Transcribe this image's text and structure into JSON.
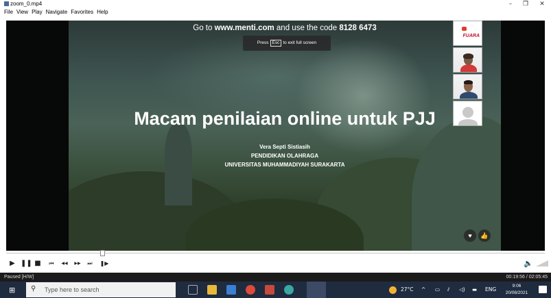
{
  "window": {
    "title": "zoom_0.mp4",
    "controls": [
      "–",
      "❐",
      "✕"
    ]
  },
  "menu": [
    "File",
    "View",
    "Play",
    "Navigate",
    "Favorites",
    "Help"
  ],
  "slide": {
    "top_banner_prefix": "Go to ",
    "top_banner_site": "www.menti.com",
    "top_banner_middle": " and use the code ",
    "top_banner_code": "8128 6473",
    "esc_prefix": "Press",
    "esc_key": "Esc",
    "esc_suffix": "to exit full screen",
    "title": "Macam penilaian online untuk PJJ",
    "author": "Vera Septi Sistiasih",
    "department": "PENDIDIKAN OLAHRAGA",
    "university": "UNIVERSITAS MUHAMMADIYAH SURAKARTA",
    "heart_icon": "heart-icon",
    "like_icon": "thumbs-up-icon"
  },
  "participants": {
    "logo_text": "FUARA"
  },
  "player": {
    "controls": {
      "play": "▶",
      "pause": "❚❚",
      "stop": "■",
      "prev": "⏮",
      "rewind": "◀◀",
      "forward": "▶▶",
      "next": "⏭",
      "frame_step": "❚▶"
    },
    "volume_icon": "🔈",
    "status": "Paused [H/W]",
    "time": "00:19:56 / 02:05:45"
  },
  "taskbar": {
    "start_icon": "windows-icon",
    "search_placeholder": "Type here to search",
    "weather": "27°C",
    "tray_arrow": "^",
    "language": "ENG",
    "time": "9:06",
    "date": "20/08/2021"
  },
  "colors": {
    "taskbar": "#1f2b3f",
    "status_bar": "#1b1b1b",
    "video_bg": "#070808"
  }
}
